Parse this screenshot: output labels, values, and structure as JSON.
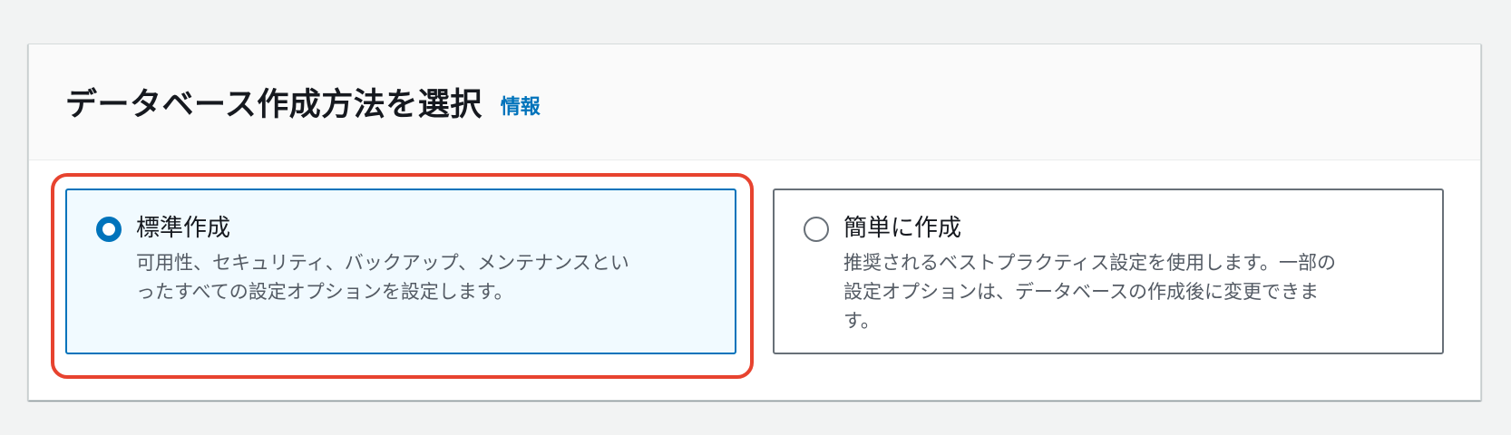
{
  "panel": {
    "title": "データベース作成方法を選択",
    "info_link": "情報"
  },
  "options": [
    {
      "label": "標準作成",
      "desc_line1": "可用性、セキュリティ、バックアップ、メンテナンスとい",
      "desc_line2": "ったすべての設定オプションを設定します。",
      "desc_line3": "",
      "selected": true
    },
    {
      "label": "簡単に作成",
      "desc_line1": "推奨されるベストプラクティス設定を使用します。一部の",
      "desc_line2": "設定オプションは、データベースの作成後に変更できま",
      "desc_line3": "す。",
      "selected": false
    }
  ],
  "colors": {
    "accent": "#0073bb",
    "highlight": "#e7432f",
    "selected_bg": "#f1faff"
  }
}
